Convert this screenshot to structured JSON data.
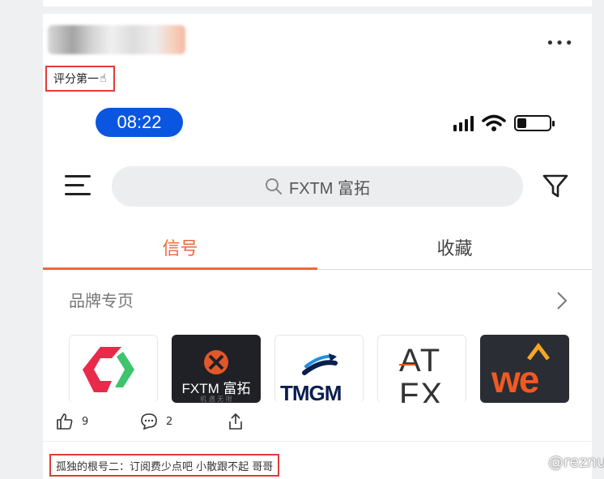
{
  "post": {
    "more_label": "•••",
    "tag_text": "评分第一",
    "tag_emoji": "☝"
  },
  "phone": {
    "time": "08:22",
    "search_text": "FXTM 富拓",
    "tabs": [
      {
        "label": "信号",
        "active": true
      },
      {
        "label": "收藏",
        "active": false
      }
    ],
    "brand_section_title": "品牌专页",
    "battery_level": 0.3,
    "logos": [
      {
        "name": "logo-1"
      },
      {
        "name": "FXTM",
        "text": "FXTM 富拓",
        "sub": "机 遇 无 限"
      },
      {
        "name": "TMGM",
        "text": "TMGM"
      },
      {
        "name": "ATFX",
        "text": "AT\nFX"
      },
      {
        "name": "WE",
        "text": "we"
      }
    ],
    "accent_color": "#ea6a3a",
    "time_pill_color": "#0a56e0"
  },
  "actions": {
    "like_count": "9",
    "comment_count": "2"
  },
  "comment": {
    "text": "孤独的根号二：订阅费少点吧 小散跟不起 哥哥"
  },
  "watermark": "@reznue"
}
